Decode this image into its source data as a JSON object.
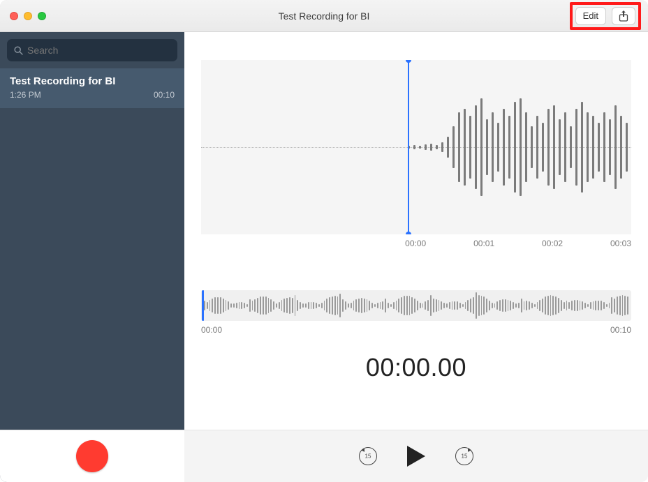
{
  "titlebar": {
    "title": "Test Recording for BI",
    "edit_label": "Edit"
  },
  "sidebar": {
    "search_placeholder": "Search",
    "recordings": [
      {
        "title": "Test Recording for BI",
        "time": "1:26 PM",
        "duration": "00:10"
      }
    ]
  },
  "main": {
    "zoom_ticks": [
      "00:00",
      "00:01",
      "00:02",
      "00:03"
    ],
    "overview_start": "00:00",
    "overview_end": "00:10",
    "current_time": "00:00.00",
    "skip_seconds": "15"
  }
}
